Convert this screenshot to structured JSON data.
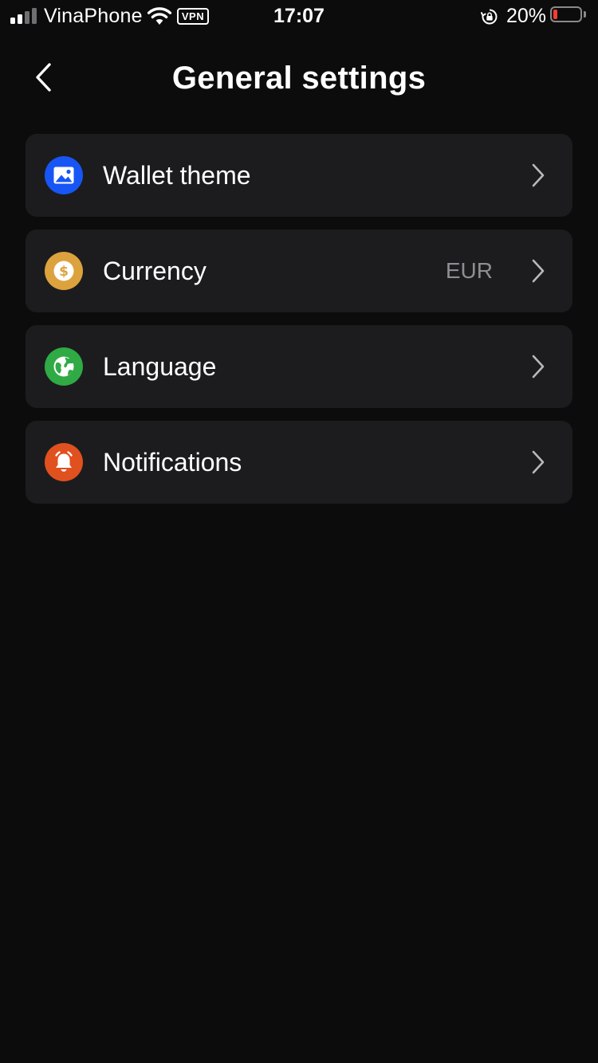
{
  "status_bar": {
    "carrier": "VinaPhone",
    "vpn_label": "VPN",
    "time": "17:07",
    "battery_percent": "20%",
    "battery_level": 0.2,
    "battery_color": "#ff3b30",
    "signal_bars_active": 2,
    "signal_bars_total": 4
  },
  "header": {
    "title": "General settings",
    "back_icon": "chevron-left-icon"
  },
  "settings": [
    {
      "label": "Wallet theme",
      "value": "",
      "icon": "image-icon",
      "icon_color": "#1756f5"
    },
    {
      "label": "Currency",
      "value": "EUR",
      "icon": "dollar-coin-icon",
      "icon_color": "#dca23e"
    },
    {
      "label": "Language",
      "value": "",
      "icon": "globe-icon",
      "icon_color": "#2faa45"
    },
    {
      "label": "Notifications",
      "value": "",
      "icon": "bell-icon",
      "icon_color": "#e0511f"
    }
  ]
}
